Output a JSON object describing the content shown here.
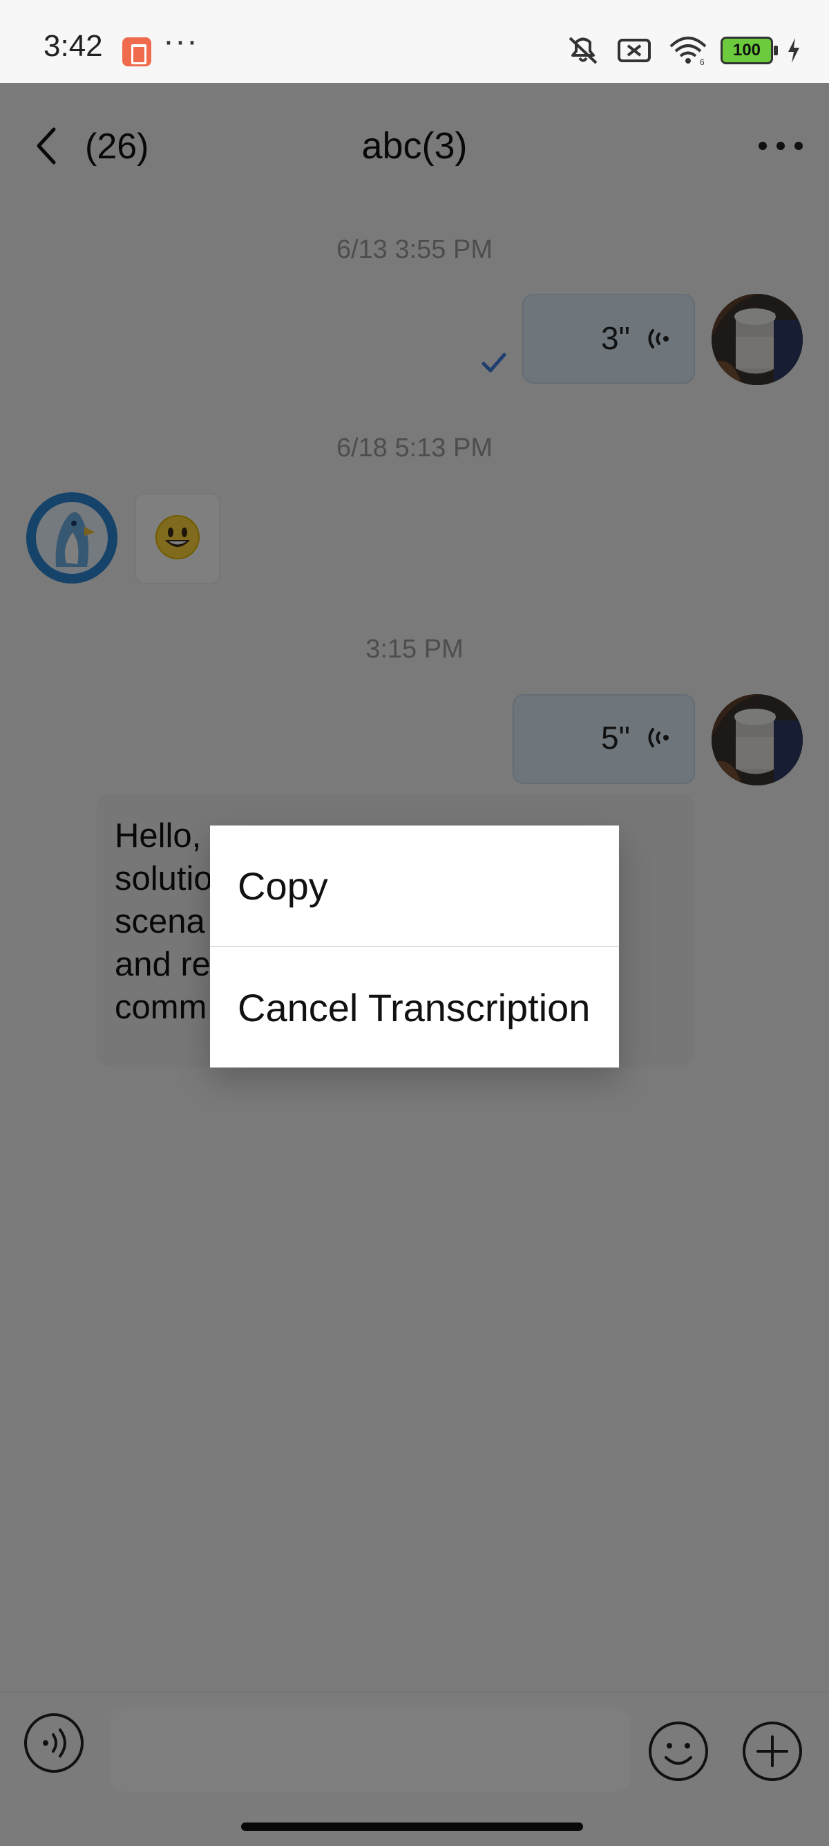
{
  "status_bar": {
    "time": "3:42",
    "dots": "···",
    "battery_text": "100",
    "icons": [
      "app-icon",
      "mute-icon",
      "battery-saver-icon",
      "wifi-6-icon",
      "battery-icon",
      "charging-bolt-icon"
    ]
  },
  "header": {
    "back_count": "(26)",
    "title": "abc(3)",
    "back_icon": "chevron-left-icon",
    "menu_icon": "more-horizontal-icon"
  },
  "messages": [
    {
      "timestamp": "6/13 3:55 PM"
    },
    {
      "voice_duration": "3\"",
      "read_status_icon": "check-icon"
    },
    {
      "timestamp": "6/18 5:13 PM"
    },
    {
      "emoji_icon": "grinning-face-icon"
    },
    {
      "timestamp": "3:15 PM"
    },
    {
      "voice_duration": "5\""
    },
    {
      "transcription_text": "Hello,\nsolutio\nscena\nand re\ncomm"
    }
  ],
  "popup_menu": {
    "items": [
      {
        "label": "Copy"
      },
      {
        "label": "Cancel Transcription"
      }
    ]
  },
  "bottom_bar": {
    "voice_icon": "voice-input-icon",
    "emoji_icon": "emoji-icon",
    "plus_icon": "plus-icon"
  },
  "colors": {
    "overlay": "#000000",
    "voice_bubble": "#dceaf7",
    "transcription_bubble": "#efefef",
    "popup": "#ffffff"
  }
}
